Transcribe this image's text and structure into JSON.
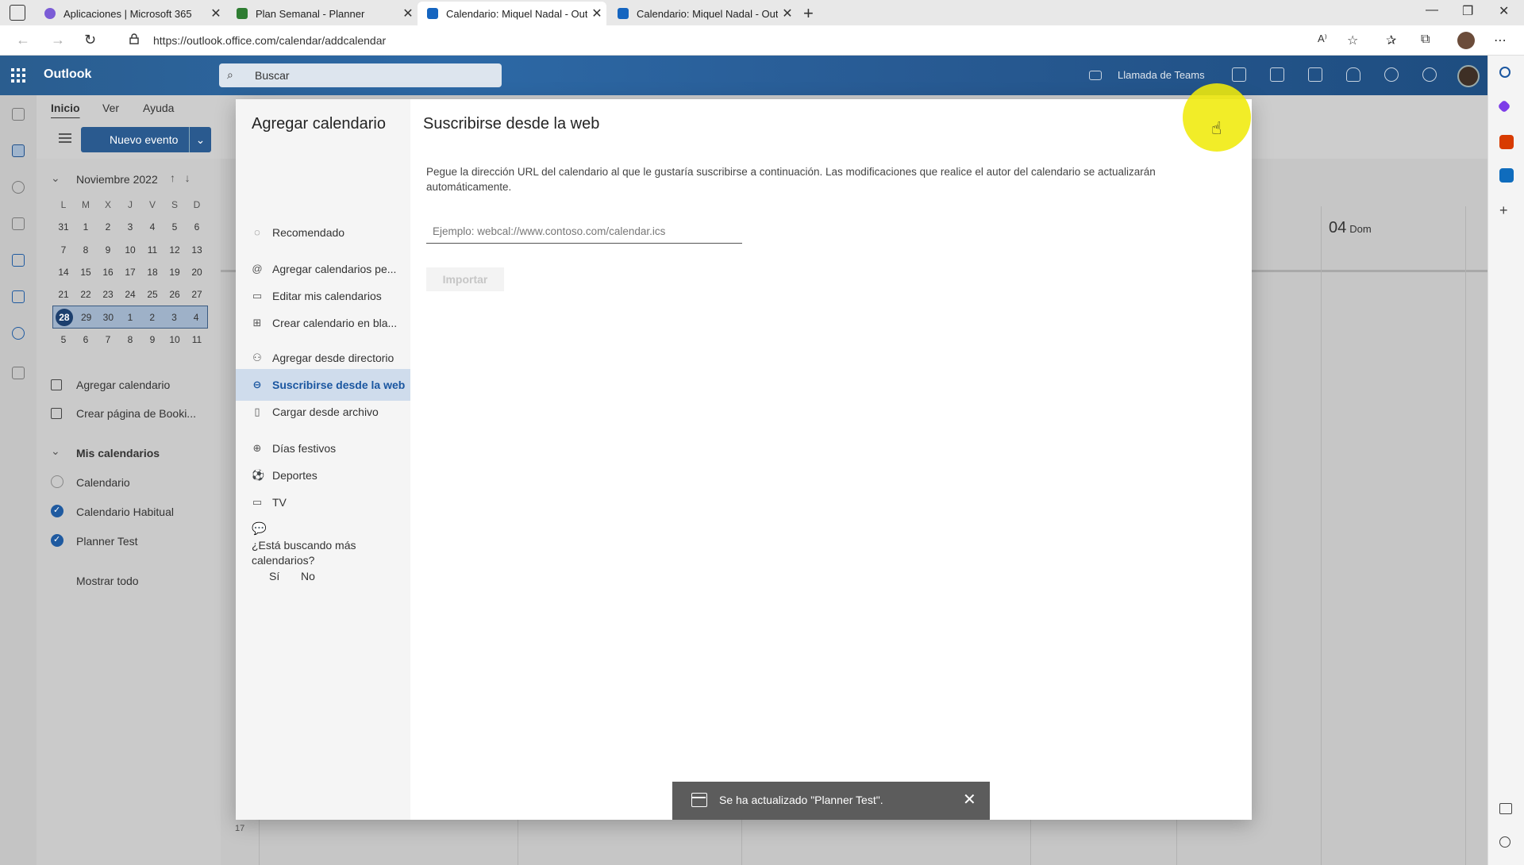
{
  "browser": {
    "tabs": [
      {
        "title": "Aplicaciones | Microsoft 365",
        "color": "#7b5cd6"
      },
      {
        "title": "Plan Semanal - Planner",
        "color": "#2e7d32"
      },
      {
        "title": "Calendario: Miquel Nadal - Outlo",
        "color": "#1565c0"
      },
      {
        "title": "Calendario: Miquel Nadal - Outlo",
        "color": "#1565c0"
      }
    ],
    "url": "https://outlook.office.com/calendar/addcalendar"
  },
  "outlook": {
    "app_name": "Outlook",
    "search_placeholder": "Buscar",
    "teams_call": "Llamada de Teams",
    "ribbon_tabs": [
      "Inicio",
      "Ver",
      "Ayuda"
    ],
    "new_event": "Nuevo evento",
    "mini_calendar": {
      "month": "Noviembre 2022",
      "weekdays": [
        "L",
        "M",
        "X",
        "J",
        "V",
        "S",
        "D"
      ],
      "weeks": [
        [
          "31",
          "1",
          "2",
          "3",
          "4",
          "5",
          "6"
        ],
        [
          "7",
          "8",
          "9",
          "10",
          "11",
          "12",
          "13"
        ],
        [
          "14",
          "15",
          "16",
          "17",
          "18",
          "19",
          "20"
        ],
        [
          "21",
          "22",
          "23",
          "24",
          "25",
          "26",
          "27"
        ],
        [
          "28",
          "29",
          "30",
          "1",
          "2",
          "3",
          "4"
        ],
        [
          "5",
          "6",
          "7",
          "8",
          "9",
          "10",
          "11"
        ]
      ],
      "today": "28"
    },
    "left_pane": {
      "add_calendar": "Agregar calendario",
      "bookings": "Crear página de Booki...",
      "my_calendars": "Mis calendarios",
      "calendars": [
        {
          "name": "Calendario",
          "checked": false
        },
        {
          "name": "Calendario Habitual",
          "checked": true
        },
        {
          "name": "Planner Test",
          "checked": true
        }
      ],
      "show_all": "Mostrar todo"
    },
    "day_header": {
      "num": "04",
      "name": "Dom"
    },
    "hour_label": "17"
  },
  "modal": {
    "side_title": "Agregar calendario",
    "items": [
      {
        "label": "Recomendado",
        "icon": "lightbulb-icon",
        "glyph": "◌"
      },
      {
        "label": "Agregar calendarios pe...",
        "icon": "at-icon",
        "glyph": "@"
      },
      {
        "label": "Editar mis calendarios",
        "icon": "edit-calendar-icon",
        "glyph": "▭"
      },
      {
        "label": "Crear calendario en bla...",
        "icon": "add-calendar-icon",
        "glyph": "⊞"
      },
      {
        "label": "Agregar desde directorio",
        "icon": "people-icon",
        "glyph": "⚇"
      },
      {
        "label": "Suscribirse desde la web",
        "icon": "link-icon",
        "glyph": "⊖"
      },
      {
        "label": "Cargar desde archivo",
        "icon": "file-icon",
        "glyph": "▯"
      },
      {
        "label": "Días festivos",
        "icon": "globe-icon",
        "glyph": "⊕"
      },
      {
        "label": "Deportes",
        "icon": "sports-icon",
        "glyph": "⚽"
      },
      {
        "label": "TV",
        "icon": "tv-icon",
        "glyph": "▭"
      }
    ],
    "selected_index": 5,
    "feedback_question": "¿Está buscando más calendarios?",
    "feedback_yes": "Sí",
    "feedback_no": "No",
    "title": "Suscribirse desde la web",
    "description": "Pegue la dirección URL del calendario al que le gustaría suscribirse a continuación. Las modificaciones que realice el autor del calendario se actualizarán automáticamente.",
    "url_placeholder": "Ejemplo: webcal://www.contoso.com/calendar.ics",
    "url_value": "",
    "import_label": "Importar"
  },
  "toast": {
    "message": "Se ha actualizado \"Planner Test\"."
  }
}
